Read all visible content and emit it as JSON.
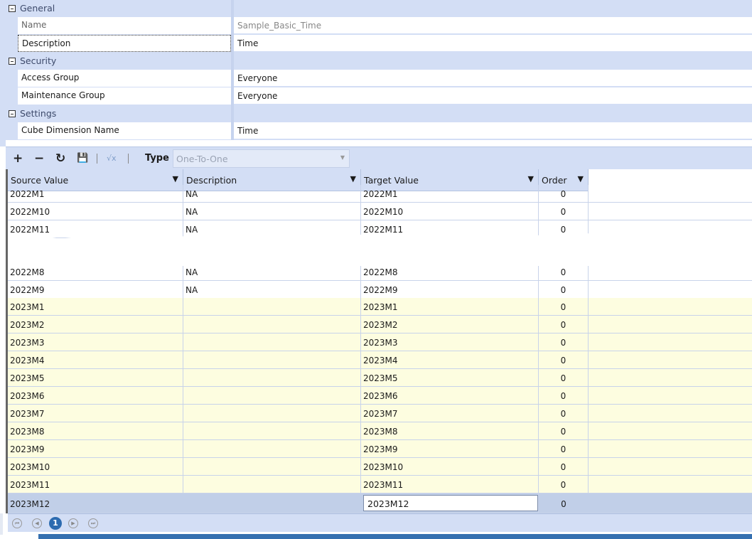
{
  "properties": {
    "general": {
      "label": "General",
      "name_label": "Name",
      "name_value": "Sample_Basic_Time",
      "desc_label": "Description",
      "desc_value": "Time"
    },
    "security": {
      "label": "Security",
      "access_label": "Access Group",
      "access_value": "Everyone",
      "maint_label": "Maintenance Group",
      "maint_value": "Everyone"
    },
    "settings": {
      "label": "Settings",
      "cube_label": "Cube Dimension Name",
      "cube_value": "Time"
    }
  },
  "toolbar": {
    "add": "+",
    "remove": "−",
    "refresh": "↻",
    "save": "💾",
    "formula": "√x",
    "type_label": "Type",
    "type_value": "One-To-One"
  },
  "grid": {
    "columns": [
      "Source Value",
      "Description",
      "Target Value",
      "Order"
    ],
    "rows_top": [
      [
        "2022M1",
        "NA",
        "2022M1",
        "0"
      ],
      [
        "2022M10",
        "NA",
        "2022M10",
        "0"
      ],
      [
        "2022M11",
        "NA",
        "2022M11",
        "0"
      ]
    ],
    "rows_bottom": [
      [
        "2022M8",
        "NA",
        "2022M8",
        "0"
      ],
      [
        "2022M9",
        "NA",
        "2022M9",
        "0"
      ]
    ],
    "new_rows": [
      [
        "2023M1",
        "",
        "2023M1",
        "0"
      ],
      [
        "2023M2",
        "",
        "2023M2",
        "0"
      ],
      [
        "2023M3",
        "",
        "2023M3",
        "0"
      ],
      [
        "2023M4",
        "",
        "2023M4",
        "0"
      ],
      [
        "2023M5",
        "",
        "2023M5",
        "0"
      ],
      [
        "2023M6",
        "",
        "2023M6",
        "0"
      ],
      [
        "2023M7",
        "",
        "2023M7",
        "0"
      ],
      [
        "2023M8",
        "",
        "2023M8",
        "0"
      ],
      [
        "2023M9",
        "",
        "2023M9",
        "0"
      ],
      [
        "2023M10",
        "",
        "2023M10",
        "0"
      ],
      [
        "2023M11",
        "",
        "2023M11",
        "0"
      ]
    ],
    "selected_row": [
      "2023M12",
      "",
      "2023M12",
      "0"
    ]
  },
  "pager": {
    "page": "1"
  },
  "colors": {
    "panel": "#d3def5",
    "new_row": "#fdfde0",
    "selected": "#c1cfe8",
    "accent": "#2c6bb0"
  }
}
